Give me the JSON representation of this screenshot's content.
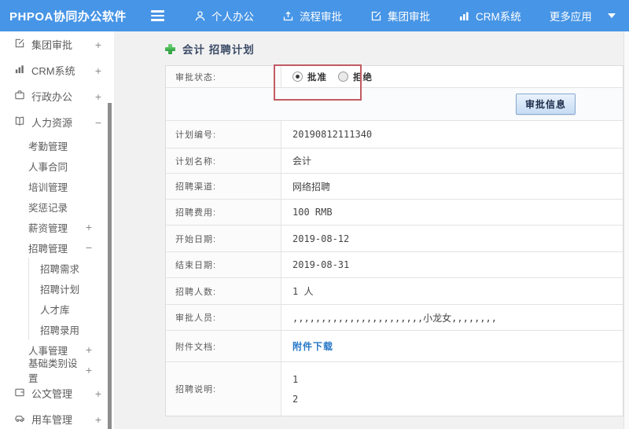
{
  "header": {
    "logo": "PHPOA协同办公软件",
    "nav": [
      {
        "label": "个人办公",
        "icon": "user-icon"
      },
      {
        "label": "流程审批",
        "icon": "workflow-icon"
      },
      {
        "label": "集团审批",
        "icon": "edit-icon"
      },
      {
        "label": "CRM系统",
        "icon": "bar-chart-icon"
      },
      {
        "label": "更多应用",
        "icon": "caret-down-icon"
      }
    ]
  },
  "sidebar": {
    "items": [
      {
        "label": "集团审批",
        "icon": "edit-icon",
        "expander": "+",
        "level": 1
      },
      {
        "label": "CRM系统",
        "icon": "bar-chart-icon",
        "expander": "+",
        "level": 1
      },
      {
        "label": "行政办公",
        "icon": "briefcase-icon",
        "expander": "+",
        "level": 1
      },
      {
        "label": "人力资源",
        "icon": "book-icon",
        "expander": "−",
        "level": 1
      },
      {
        "label": "考勤管理",
        "level": 2
      },
      {
        "label": "人事合同",
        "level": 2
      },
      {
        "label": "培训管理",
        "level": 2
      },
      {
        "label": "奖惩记录",
        "level": 2
      },
      {
        "label": "薪资管理",
        "expander": "+",
        "level": 2
      },
      {
        "label": "招聘管理",
        "expander": "−",
        "level": 2
      },
      {
        "label": "招聘需求",
        "level": 3
      },
      {
        "label": "招聘计划",
        "level": 3
      },
      {
        "label": "人才库",
        "level": 3
      },
      {
        "label": "招聘录用",
        "level": 3
      },
      {
        "label": "人事管理",
        "expander": "+",
        "level": 2
      },
      {
        "label": "基础类别设置",
        "expander": "+",
        "level": 2
      },
      {
        "label": "公文管理",
        "icon": "folder-icon",
        "expander": "+",
        "level": 1
      },
      {
        "label": "用车管理",
        "icon": "car-icon",
        "expander": "+",
        "level": 1
      }
    ]
  },
  "main": {
    "title": "会计 招聘计划",
    "approval": {
      "label": "审批状态:",
      "options": [
        {
          "label": "批准",
          "checked": true
        },
        {
          "label": "拒绝",
          "checked": false
        }
      ],
      "button_label": "审批信息"
    },
    "fields": [
      {
        "label": "计划编号:",
        "value": "20190812111340"
      },
      {
        "label": "计划名称:",
        "value": "会计"
      },
      {
        "label": "招聘渠道:",
        "value": "网络招聘"
      },
      {
        "label": "招聘费用:",
        "value": "100 RMB"
      },
      {
        "label": "开始日期:",
        "value": "2019-08-12"
      },
      {
        "label": "结束日期:",
        "value": "2019-08-31"
      },
      {
        "label": "招聘人数:",
        "value": "1 人"
      },
      {
        "label": "审批人员:",
        "value": ",,,,,,,,,,,,,,,,,,,,,,,小龙女,,,,,,,,"
      },
      {
        "label": "附件文档:",
        "value": "附件下载",
        "type": "link"
      },
      {
        "label": "招聘说明:",
        "lines": [
          "1",
          "2"
        ]
      }
    ]
  },
  "colors": {
    "header_blue": "#4795e6",
    "content_bg": "#f1f1f2",
    "annotation_red": "#c15b63",
    "link_blue": "#2878c8",
    "button_bg": "#c6dcf4"
  }
}
